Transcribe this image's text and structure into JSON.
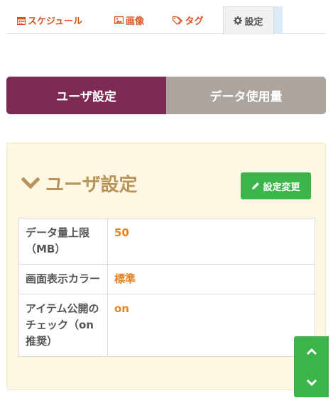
{
  "tabs": {
    "schedule": "スケジュール",
    "images": "画像",
    "tags": "タグ",
    "settings": "設定"
  },
  "segmented": {
    "user_settings": "ユーザ設定",
    "data_usage": "データ使用量"
  },
  "panel": {
    "title": "ユーザ設定",
    "edit_button": "設定変更",
    "rows": [
      {
        "label": "データ量上限（MB）",
        "value": "50"
      },
      {
        "label": "画面表示カラー",
        "value": "標準"
      },
      {
        "label": "アイテム公開のチェック（on推奨）",
        "value": "on"
      }
    ]
  },
  "colors": {
    "accent_orange": "#d9541e",
    "segment_active": "#7d2a55",
    "segment_inactive": "#aba49f",
    "panel_bg": "#fdf7e3",
    "panel_title": "#b8935a",
    "green_button": "#3bb54a",
    "value_orange": "#e8821e"
  },
  "icons": {
    "schedule": "calendar-icon",
    "images": "image-icon",
    "tags": "tag-icon",
    "settings": "gear-icon",
    "panel": "chevron-down-icon",
    "edit": "pencil-icon",
    "scroll_up": "chevron-up-icon",
    "scroll_down": "chevron-down-icon"
  }
}
